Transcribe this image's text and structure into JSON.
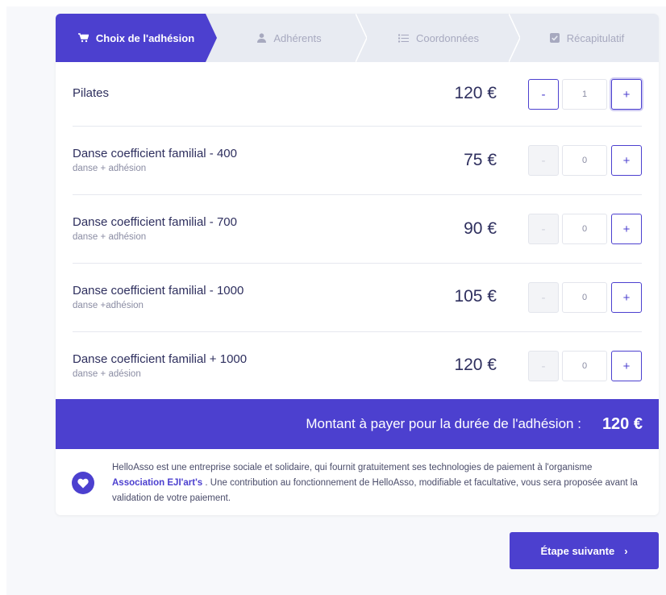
{
  "stepper": {
    "steps": [
      {
        "label": "Choix de l'adhésion",
        "icon": "cart-icon",
        "active": true
      },
      {
        "label": "Adhérents",
        "icon": "user-icon",
        "active": false
      },
      {
        "label": "Coordonnées",
        "icon": "list-icon",
        "active": false
      },
      {
        "label": "Récapitulatif",
        "icon": "checkbox-icon",
        "active": false
      }
    ]
  },
  "items": [
    {
      "name": "Pilates",
      "sub": "",
      "price": "120 €",
      "qty": "1"
    },
    {
      "name": "Danse coefficient familial - 400",
      "sub": "danse + adhésion",
      "price": "75 €",
      "qty": "0"
    },
    {
      "name": "Danse coefficient familial - 700",
      "sub": "danse + adhésion",
      "price": "90 €",
      "qty": "0"
    },
    {
      "name": "Danse coefficient familial - 1000",
      "sub": "danse +adhésion",
      "price": "105 €",
      "qty": "0"
    },
    {
      "name": "Danse coefficient familial + 1000",
      "sub": "danse + adésion",
      "price": "120 €",
      "qty": "0"
    }
  ],
  "quantity": {
    "minus_label": "-",
    "plus_label": "+"
  },
  "total": {
    "label": "Montant à payer pour la durée de l'adhésion :",
    "amount": "120 €"
  },
  "info": {
    "text_before": "HelloAsso est une entreprise sociale et solidaire, qui fournit gratuitement ses technologies de paiement à l'organisme ",
    "association": "Association EJI'art's",
    "text_after": " . Une contribution au fonctionnement de HelloAsso, modifiable et facultative, vous sera proposée avant la validation de votre paiement."
  },
  "next_button": {
    "label": "Étape suivante",
    "chevron": "›"
  },
  "colors": {
    "accent": "#4c40cf",
    "background": "#f7f8fb",
    "text": "#2e2f5e"
  }
}
